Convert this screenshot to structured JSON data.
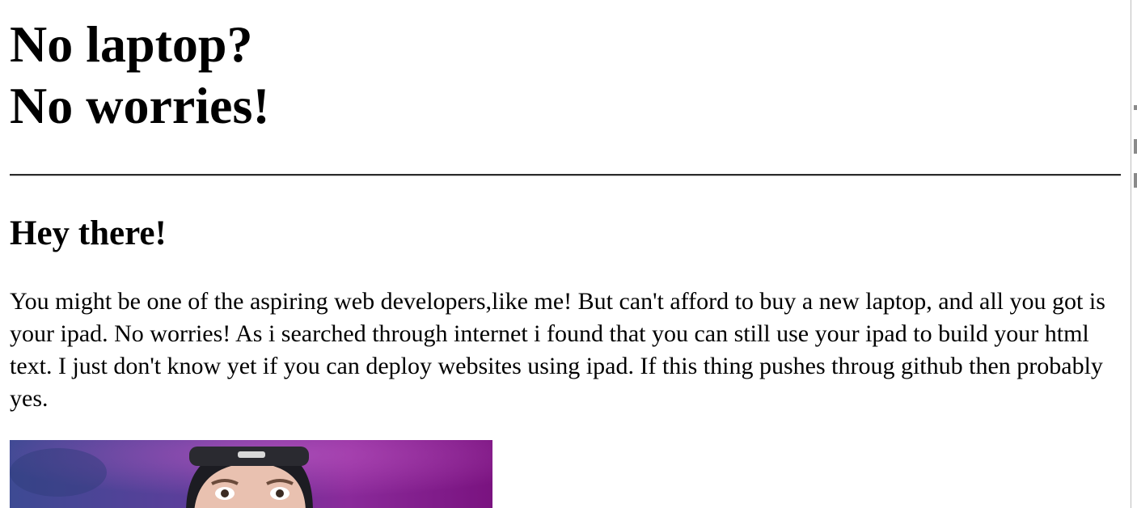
{
  "header": {
    "title_line1": "No laptop?",
    "title_line2": "No worries!"
  },
  "section": {
    "heading": "Hey there!",
    "paragraph": "You might be one of the aspiring web developers,like me! But can't afford to buy a new laptop, and all you got is your ipad. No worries! As i searched through internet i found that you can still use your ipad to build your html text. I just don't know yet if you can deploy websites using ipad. If this thing pushes throug github then probably yes."
  },
  "image": {
    "subject": "man wearing backwards black cap on purple background"
  },
  "colors": {
    "background": "#ffffff",
    "text": "#000000",
    "photo_purple": "#8a1f8f",
    "photo_blue": "#3e4f95"
  }
}
